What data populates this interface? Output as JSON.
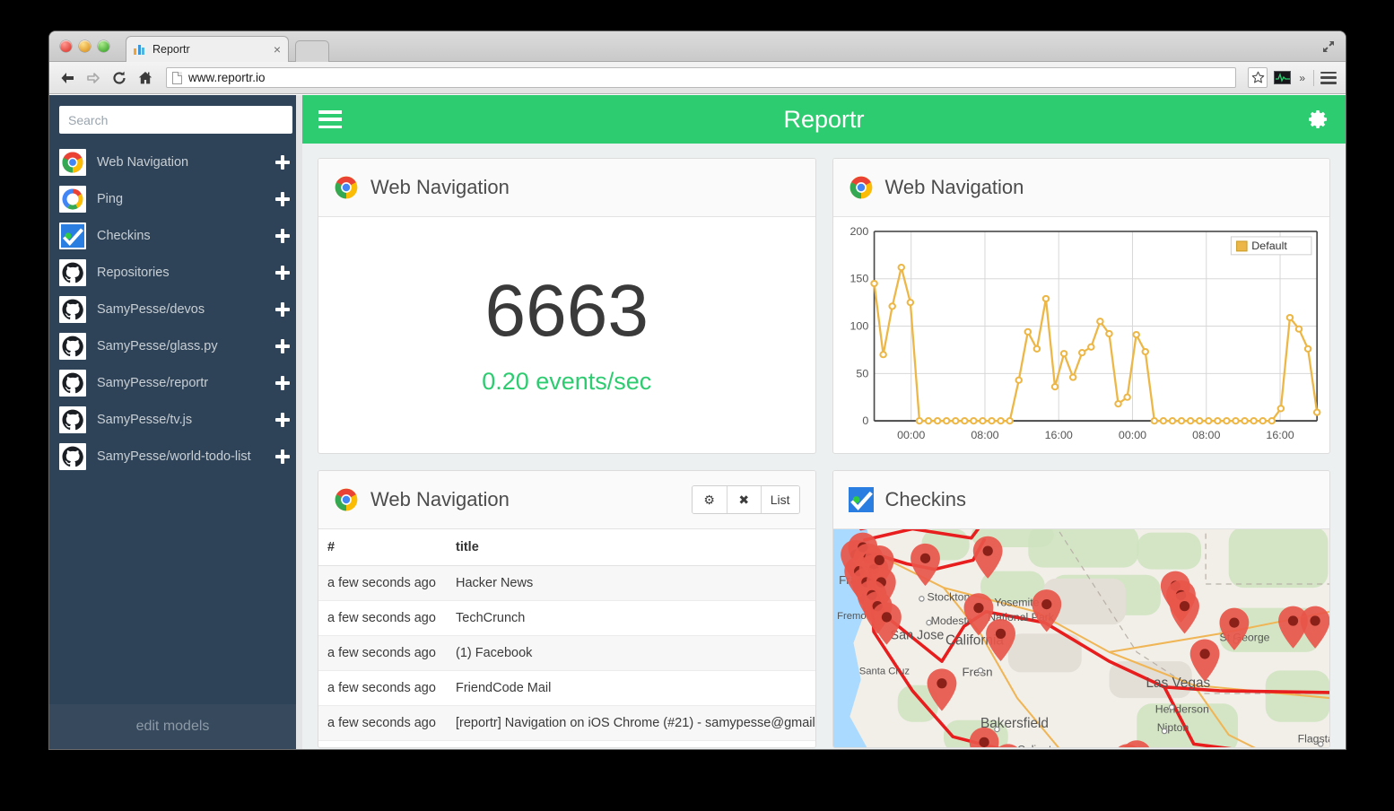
{
  "browser": {
    "tab_title": "Reportr",
    "tab_close_label": "×",
    "url": "www.reportr.io",
    "chevron_label": "»"
  },
  "sidebar": {
    "search_placeholder": "Search",
    "edit_models_label": "edit models",
    "items": [
      {
        "label": "Web Navigation",
        "icon": "chrome-icon"
      },
      {
        "label": "Ping",
        "icon": "ping-ring-icon"
      },
      {
        "label": "Checkins",
        "icon": "checkmark-icon"
      },
      {
        "label": "Repositories",
        "icon": "github-icon"
      },
      {
        "label": "SamyPesse/devos",
        "icon": "github-icon"
      },
      {
        "label": "SamyPesse/glass.py",
        "icon": "github-icon"
      },
      {
        "label": "SamyPesse/reportr",
        "icon": "github-icon"
      },
      {
        "label": "SamyPesse/tv.js",
        "icon": "github-icon"
      },
      {
        "label": "SamyPesse/world-todo-list",
        "icon": "github-icon"
      }
    ]
  },
  "header": {
    "title": "Reportr",
    "menu_icon": "hamburger-icon",
    "settings_icon": "gear-icon"
  },
  "panels": {
    "counter": {
      "title": "Web Navigation",
      "icon": "chrome-icon",
      "value": "6663",
      "rate": "0.20 events/sec"
    },
    "chart": {
      "title": "Web Navigation",
      "icon": "chrome-icon"
    },
    "table": {
      "title": "Web Navigation",
      "icon": "chrome-icon",
      "buttons": [
        {
          "label": "⚙",
          "name": "settings-button"
        },
        {
          "label": "✖",
          "name": "close-button"
        },
        {
          "label": "List",
          "name": "list-button"
        }
      ],
      "columns": [
        "#",
        "title"
      ],
      "rows": [
        [
          "a few seconds ago",
          "Hacker News"
        ],
        [
          "a few seconds ago",
          "TechCrunch"
        ],
        [
          "a few seconds ago",
          "(1) Facebook"
        ],
        [
          "a few seconds ago",
          "FriendCode Mail"
        ],
        [
          "a few seconds ago",
          "[reportr] Navigation on iOS Chrome (#21) - samypesse@gmail"
        ]
      ]
    },
    "map": {
      "title": "Checkins",
      "icon": "checkmark-icon",
      "labels": [
        "Fran",
        "Fremo",
        "Santa Cruz",
        "San Jose",
        "Stockton",
        "Modesto",
        "Yosemite",
        "National Park",
        "California",
        "Fresn",
        "Bakersfield",
        "Caliente",
        "Las Vegas",
        "Henderson",
        "Nipton",
        "St George",
        "Flagsta"
      ]
    }
  },
  "colors": {
    "accent_green": "#2ecc71",
    "sidebar_navy": "#2f4358",
    "chart_series": "#edb747",
    "counter_text": "#3a3a3a"
  },
  "chart_data": {
    "type": "line",
    "title": "Web Navigation",
    "xlabel": "",
    "ylabel": "",
    "ylim": [
      0,
      200
    ],
    "yticks": [
      0,
      50,
      100,
      150,
      200
    ],
    "xticks": [
      "00:00",
      "08:00",
      "16:00",
      "00:00",
      "08:00",
      "16:00"
    ],
    "grid": true,
    "legend_position": "top-right",
    "series": [
      {
        "name": "Default",
        "color": "#edb747",
        "values": [
          145,
          70,
          121,
          162,
          125,
          0,
          0,
          0,
          0,
          0,
          0,
          0,
          0,
          0,
          0,
          0,
          43,
          94,
          76,
          129,
          36,
          71,
          46,
          72,
          78,
          105,
          92,
          18,
          25,
          91,
          73,
          0,
          0,
          0,
          0,
          0,
          0,
          0,
          0,
          0,
          0,
          0,
          0,
          0,
          0,
          13,
          109,
          97,
          76,
          9
        ]
      }
    ]
  }
}
